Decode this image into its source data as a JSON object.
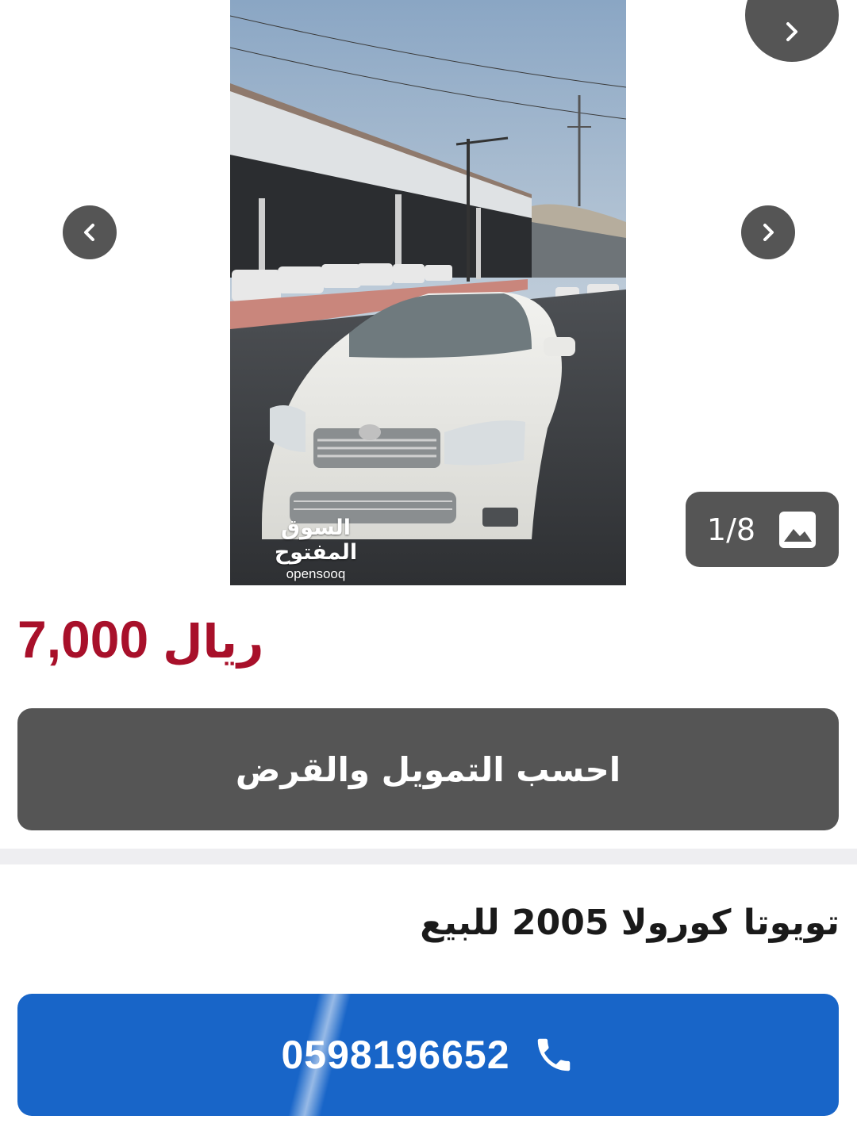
{
  "gallery": {
    "counter": "1/8",
    "watermark_ar": "السوق المفتوح",
    "watermark_en": "opensooq",
    "icons": {
      "top": "chevron-right-icon",
      "prev": "chevron-left-icon",
      "next": "chevron-right-icon",
      "counter": "image-icon"
    }
  },
  "price": {
    "amount": "7,000",
    "currency": "ريال",
    "color": "#a8102a"
  },
  "finance_button": {
    "label": "احسب التمويل والقرض"
  },
  "listing": {
    "title": "تويوتا كورولا 2005 للبيع"
  },
  "call_button": {
    "phone": "0598196652",
    "icon": "phone-icon",
    "color": "#1865c8"
  }
}
